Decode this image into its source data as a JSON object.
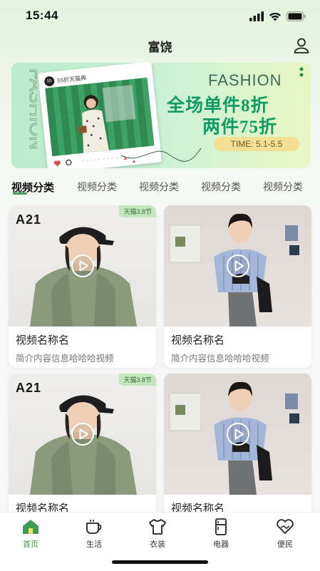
{
  "status_bar": {
    "time": "15:44"
  },
  "nav": {
    "title": "富饶"
  },
  "banner": {
    "vertical_text": "FASHION",
    "photo_caption": "55折天猫典",
    "photo_badge": "55",
    "fashion_word": "FASHION",
    "line1": "全场单件8折",
    "line2": "两件75折",
    "time": "TIME:  5.1-5.5"
  },
  "tabs": [
    "视频分类",
    "视频分类",
    "视频分类",
    "视频分类",
    "视频分类"
  ],
  "cards": [
    {
      "brand": "A21",
      "tag": "天猫3.8节",
      "title": "视频名称名",
      "desc": "简介内容信息哈哈哈视频",
      "style": "a"
    },
    {
      "brand": "",
      "tag": "",
      "title": "视频名称名",
      "desc": "简介内容信息哈哈哈视频",
      "style": "b"
    },
    {
      "brand": "A21",
      "tag": "天猫3.8节",
      "title": "视频名称名",
      "desc": "",
      "style": "a"
    },
    {
      "brand": "",
      "tag": "",
      "title": "视频名称名",
      "desc": "",
      "style": "b"
    }
  ],
  "tabbar": [
    {
      "label": "首页",
      "icon": "home-icon",
      "active": true
    },
    {
      "label": "生活",
      "icon": "coffee-cup-icon",
      "active": false
    },
    {
      "label": "衣装",
      "icon": "shirt-icon",
      "active": false
    },
    {
      "label": "电器",
      "icon": "fridge-icon",
      "active": false
    },
    {
      "label": "便民",
      "icon": "heart-hands-icon",
      "active": false
    }
  ],
  "colors": {
    "accent": "#3d9a52",
    "banner_text": "#0e9c64",
    "time_pill": "#f4df95"
  }
}
